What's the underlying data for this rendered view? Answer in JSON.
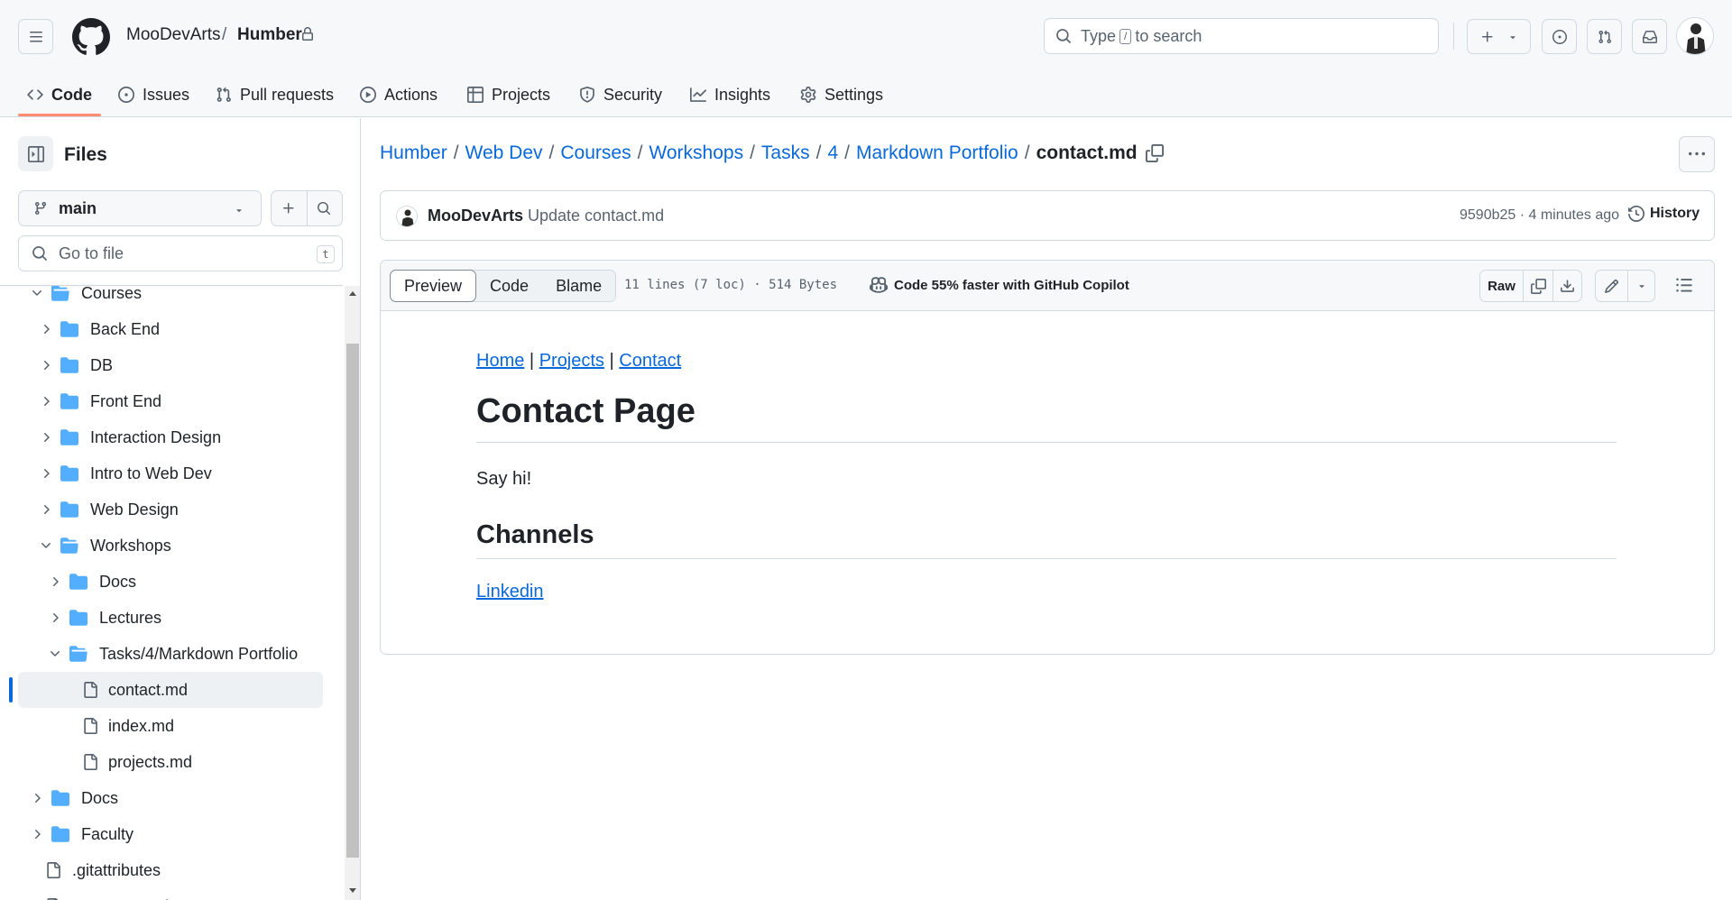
{
  "header": {
    "owner": "MooDevArts",
    "separator": "/",
    "repo": "Humber",
    "search": {
      "pre": "Type",
      "key": "/",
      "post": "to search"
    }
  },
  "tabs": [
    {
      "label": "Code",
      "icon": "code-icon",
      "active": true
    },
    {
      "label": "Issues",
      "icon": "issue-opened-icon"
    },
    {
      "label": "Pull requests",
      "icon": "git-pull-request-icon"
    },
    {
      "label": "Actions",
      "icon": "play-icon"
    },
    {
      "label": "Projects",
      "icon": "table-icon"
    },
    {
      "label": "Security",
      "icon": "shield-icon"
    },
    {
      "label": "Insights",
      "icon": "graph-icon"
    },
    {
      "label": "Settings",
      "icon": "gear-icon"
    }
  ],
  "sidebar": {
    "title": "Files",
    "branch": "main",
    "goto_placeholder": "Go to file",
    "goto_key": "t",
    "tree": [
      {
        "label": "Courses",
        "type": "folder",
        "open": true,
        "depth": 0
      },
      {
        "label": "Back End",
        "type": "folder",
        "open": false,
        "depth": 1
      },
      {
        "label": "DB",
        "type": "folder",
        "open": false,
        "depth": 1
      },
      {
        "label": "Front End",
        "type": "folder",
        "open": false,
        "depth": 1
      },
      {
        "label": "Interaction Design",
        "type": "folder",
        "open": false,
        "depth": 1
      },
      {
        "label": "Intro to Web Dev",
        "type": "folder",
        "open": false,
        "depth": 1
      },
      {
        "label": "Web Design",
        "type": "folder",
        "open": false,
        "depth": 1
      },
      {
        "label": "Workshops",
        "type": "folder",
        "open": true,
        "depth": 1
      },
      {
        "label": "Docs",
        "type": "folder",
        "open": false,
        "depth": 2
      },
      {
        "label": "Lectures",
        "type": "folder",
        "open": false,
        "depth": 2
      },
      {
        "label": "Tasks/4/Markdown Portfolio",
        "type": "folder",
        "open": true,
        "depth": 2
      },
      {
        "label": "contact.md",
        "type": "file",
        "depth": 3,
        "selected": true
      },
      {
        "label": "index.md",
        "type": "file",
        "depth": 3
      },
      {
        "label": "projects.md",
        "type": "file",
        "depth": 3
      },
      {
        "label": "Docs",
        "type": "folder",
        "open": false,
        "depth": 0
      },
      {
        "label": "Faculty",
        "type": "folder",
        "open": false,
        "depth": 0
      },
      {
        "label": ".gitattributes",
        "type": "file",
        "depth": -1
      },
      {
        "label": "README.md",
        "type": "file",
        "depth": -1
      }
    ]
  },
  "breadcrumb": {
    "links": [
      "Humber",
      "Web Dev",
      "Courses",
      "Workshops",
      "Tasks",
      "4",
      "Markdown Portfolio"
    ],
    "separator": "/",
    "current": "contact.md"
  },
  "commit": {
    "author": "MooDevArts",
    "message": "Update contact.md",
    "meta": "9590b25 · 4 minutes ago",
    "history_label": "History"
  },
  "file": {
    "views": [
      "Preview",
      "Code",
      "Blame"
    ],
    "active_view": "Preview",
    "stats": "11 lines (7 loc) · 514 Bytes",
    "copilot": "Code 55% faster with GitHub Copilot",
    "raw_label": "Raw"
  },
  "markdown": {
    "nav": [
      "Home",
      "Projects",
      "Contact"
    ],
    "nav_sep": "|",
    "h1": "Contact Page",
    "p": "Say hi!",
    "h2": "Channels",
    "link": "Linkedin"
  },
  "colors": {
    "accent_link": "#0969da",
    "tab_underline": "#fd8c73",
    "folder": "#54aeff",
    "border": "#d1d9e0"
  }
}
